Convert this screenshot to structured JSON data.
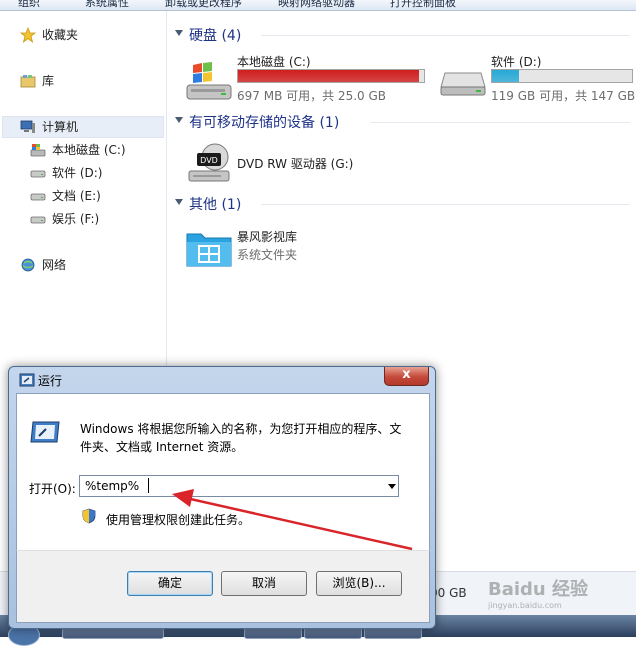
{
  "toolbar": {
    "items": [
      "组织",
      "系统属性",
      "卸载或更改程序",
      "映射网络驱动器",
      "打开控制面板"
    ]
  },
  "nav": {
    "favorites": "收藏夹",
    "library": "库",
    "computer": "计算机",
    "drives": [
      "本地磁盘 (C:)",
      "软件 (D:)",
      "文档 (E:)",
      "娱乐 (F:)"
    ],
    "network": "网络"
  },
  "content": {
    "hdd_group": "硬盘 (4)",
    "removable_group": "有可移动存储的设备 (1)",
    "other_group": "其他 (1)",
    "drive_c": {
      "name": "本地磁盘 (C:)",
      "size": "697 MB 可用，共 25.0 GB",
      "used_fraction": 0.972,
      "bar_color": "#d11d1d"
    },
    "drive_d": {
      "name": "软件 (D:)",
      "size": "119 GB 可用，共 147 GB",
      "used_fraction": 0.19,
      "bar_color": "#27a9d6"
    },
    "dvd": {
      "name": "DVD RW 驱动器 (G:)",
      "badge": "DVD"
    },
    "other": {
      "name": "暴风影视库",
      "type": "系统文件夹"
    }
  },
  "status": {
    "partial": "00 GB"
  },
  "dialog": {
    "title": "运行",
    "close": "x",
    "description": "Windows 将根据您所输入的名称，为您打开相应的程序、文件夹、文档或 Internet 资源。",
    "open_label": "打开(O):",
    "input_value": "%temp%",
    "admin_note": "使用管理权限创建此任务。",
    "ok": "确定",
    "cancel": "取消",
    "browse": "浏览(B)..."
  },
  "watermark": {
    "text": "Baidu 经验",
    "sub": "jingyan.baidu.com"
  },
  "colors": {
    "arrow": "#d9252a",
    "group_title": "#1e3287"
  }
}
